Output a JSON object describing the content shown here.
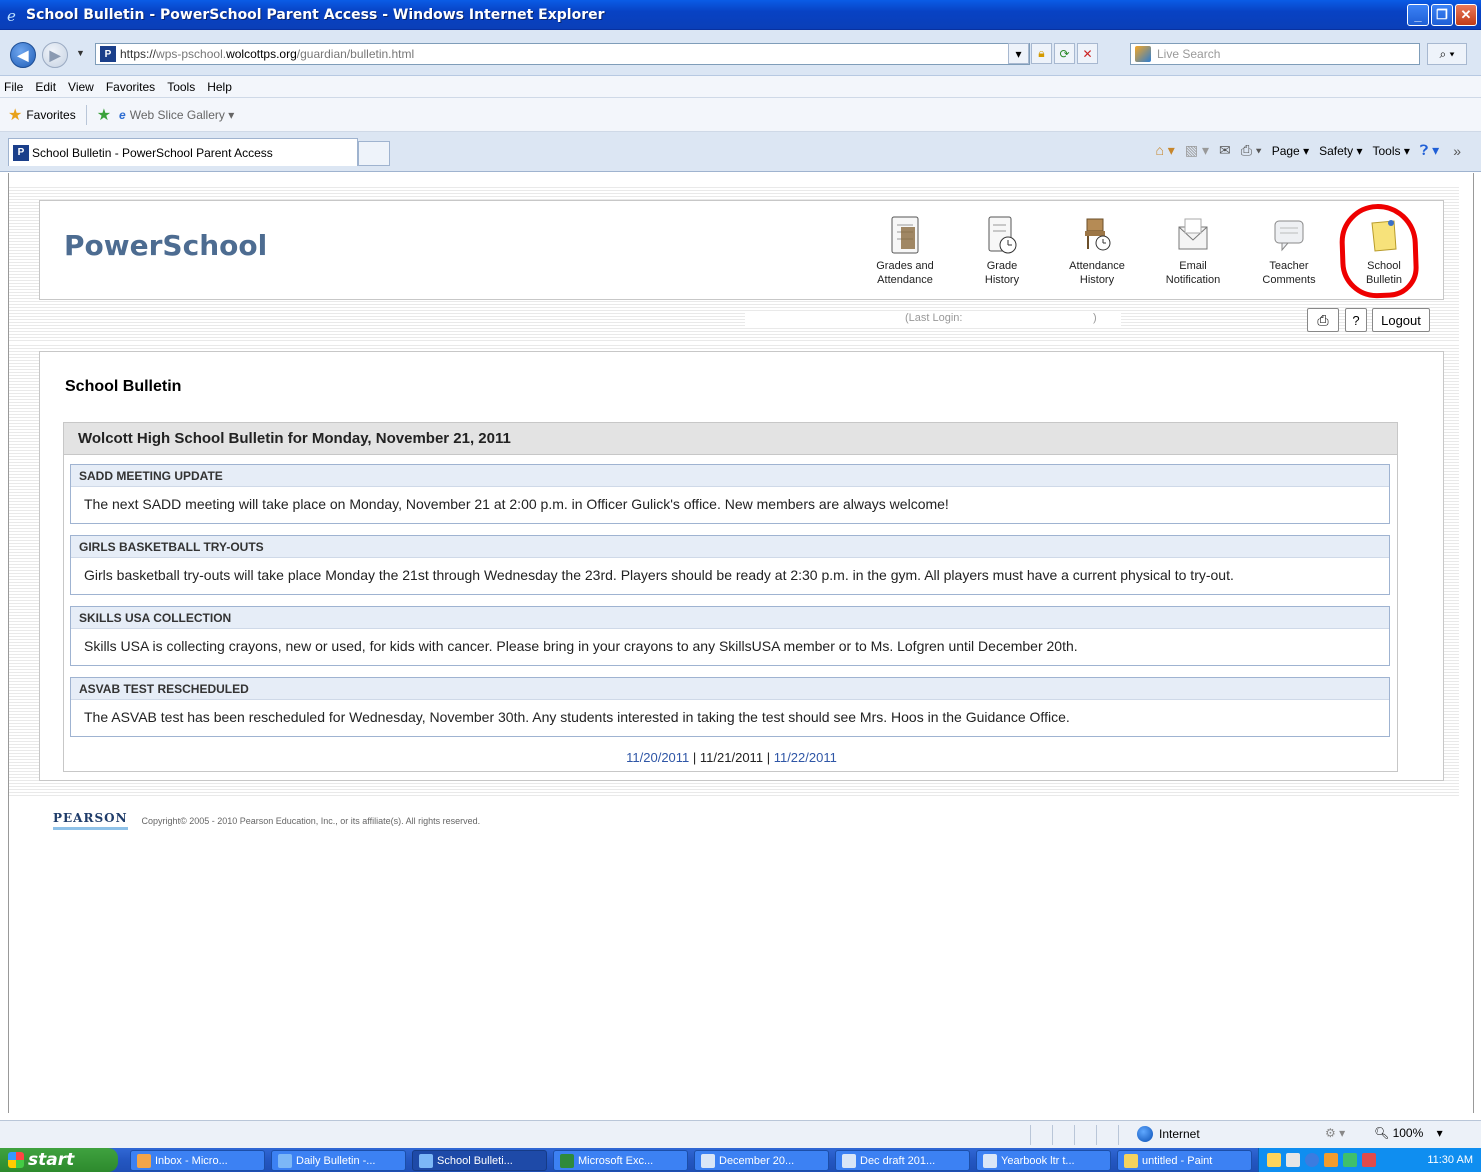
{
  "window": {
    "title": "School Bulletin - PowerSchool Parent Access - Windows Internet Explorer"
  },
  "address": {
    "url_scheme": "https://",
    "url_host_pre": "wps-pschool.",
    "url_host_domain": "wolcottps.org",
    "url_path": "/guardian/bulletin.html",
    "search_placeholder": "Live Search"
  },
  "menu": [
    "File",
    "Edit",
    "View",
    "Favorites",
    "Tools",
    "Help"
  ],
  "favorites": {
    "label": "Favorites",
    "web_slice": "Web Slice Gallery ▾"
  },
  "tab": {
    "label": "School Bulletin - PowerSchool Parent Access"
  },
  "commandbar": {
    "page": "Page ▾",
    "safety": "Safety ▾",
    "tools": "Tools ▾"
  },
  "powerschool": {
    "logo": "PowerSchool",
    "nav": [
      {
        "label": "Grades and\nAttendance",
        "icon": "grades-icon"
      },
      {
        "label": "Grade\nHistory",
        "icon": "grade-history-icon"
      },
      {
        "label": "Attendance\nHistory",
        "icon": "attendance-history-icon"
      },
      {
        "label": "Email\nNotification",
        "icon": "email-icon"
      },
      {
        "label": "Teacher\nComments",
        "icon": "comments-icon"
      },
      {
        "label": "School\nBulletin",
        "icon": "bulletin-icon"
      }
    ],
    "last_login_label": "(Last Login:",
    "last_login_close": ")",
    "help_label": "?",
    "logout_label": "Logout"
  },
  "page": {
    "title": "School Bulletin",
    "bulletin_heading": "Wolcott High School Bulletin for Monday, November 21, 2011",
    "items": [
      {
        "title": "SADD MEETING UPDATE",
        "body": "The next SADD meeting will take place on Monday, November 21 at 2:00 p.m. in Officer Gulick's office. New members are always welcome!"
      },
      {
        "title": "GIRLS BASKETBALL TRY-OUTS",
        "body": "Girls basketball try-outs will take place Monday the 21st through Wednesday the 23rd. Players should be ready at 2:30 p.m. in the gym. All players must have a current physical to try-out."
      },
      {
        "title": "SKILLS USA COLLECTION",
        "body": "Skills USA is collecting crayons, new or used, for kids with cancer. Please bring in your crayons to any SkillsUSA member or to Ms. Lofgren until December 20th."
      },
      {
        "title": "ASVAB TEST RESCHEDULED",
        "body": "The ASVAB test has been rescheduled for Wednesday, November 30th. Any students interested in taking the test should see Mrs. Hoos in the Guidance Office."
      }
    ],
    "date_prev": "11/20/2011",
    "date_current": "11/21/2011",
    "date_next": "11/22/2011",
    "separator": "|"
  },
  "footer": {
    "brand": "PEARSON",
    "copyright": "Copyright© 2005 - 2010 Pearson Education, Inc., or its affiliate(s). All rights reserved."
  },
  "status": {
    "zone": "Internet",
    "zoom": "100%",
    "zoom_drop": "▾"
  },
  "taskbar": {
    "start": "start",
    "tasks": [
      "Inbox - Micro...",
      "Daily Bulletin -...",
      "School Bulleti...",
      "Microsoft Exc...",
      "December 20...",
      "Dec draft 201...",
      "Yearbook ltr t...",
      "untitled - Paint"
    ],
    "clock": "11:30 AM"
  },
  "colors": {
    "title_bar": "#0842c4",
    "link": "#2f56a6",
    "highlight": "#ee0000",
    "item_header": "#e6edf7"
  }
}
